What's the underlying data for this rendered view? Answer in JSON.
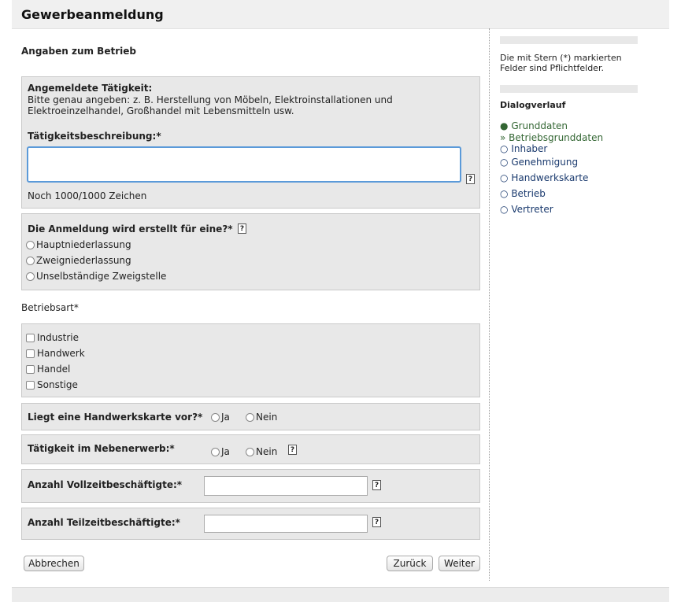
{
  "header": {
    "title": "Gewerbeanmeldung"
  },
  "main": {
    "section_title": "Angaben zum Betrieb",
    "activity": {
      "heading": "Angemeldete Tätigkeit:",
      "hint_line1": "Bitte genau angeben: z. B. Herstellung von Möbeln, Elektroinstallationen und",
      "hint_line2": "Elektroeinzelhandel, Großhandel mit Lebensmitteln usw.",
      "field_label": "Tätigkeitsbeschreibung:*",
      "field_value": "",
      "counter": "Noch 1000/1000 Zeichen"
    },
    "registration_for": {
      "label": "Die Anmeldung wird erstellt für eine?*",
      "options": [
        "Hauptniederlassung",
        "Zweigniederlassung",
        "Unselbständige Zweigstelle"
      ]
    },
    "business_type": {
      "label": "Betriebsart*",
      "options": [
        "Industrie",
        "Handwerk",
        "Handel",
        "Sonstige"
      ]
    },
    "craft_card": {
      "label": "Liegt eine Handwerkskarte vor?*",
      "yes": "Ja",
      "no": "Nein"
    },
    "side_job": {
      "label": "Tätigkeit im Nebenerwerb:*",
      "yes": "Ja",
      "no": "Nein"
    },
    "fulltime": {
      "label": "Anzahl Vollzeitbeschäftigte:*",
      "value": ""
    },
    "parttime": {
      "label": "Anzahl Teilzeitbeschäftigte:*",
      "value": ""
    },
    "help_glyph": "?",
    "buttons": {
      "cancel": "Abbrechen",
      "back": "Zurück",
      "next": "Weiter"
    }
  },
  "sidebar": {
    "note_line1": "Die mit Stern (*) markierten",
    "note_line2": "Felder sind Pflichtfelder.",
    "dialog_heading": "Dialogverlauf",
    "steps": [
      {
        "bullet": "●",
        "label": "Grunddaten"
      },
      {
        "bullet": "»",
        "label": "Betriebsgrunddaten"
      },
      {
        "bullet": "○",
        "label": "Inhaber"
      },
      {
        "bullet": "○",
        "label": "Genehmigung"
      },
      {
        "bullet": "○",
        "label": "Handwerkskarte"
      },
      {
        "bullet": "○",
        "label": "Betrieb"
      },
      {
        "bullet": "○",
        "label": "Vertreter"
      }
    ]
  },
  "colors": {
    "active_step": "#336633",
    "todo_step": "#1a3a6e",
    "focus_border": "#5b9ad9"
  }
}
